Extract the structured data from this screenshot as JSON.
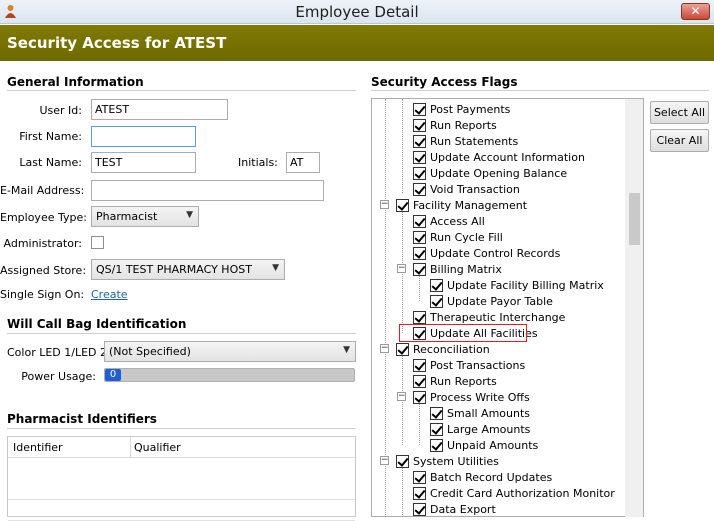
{
  "window": {
    "title": "Employee Detail",
    "close_label": "✕"
  },
  "header": {
    "title": "Security Access for ATEST"
  },
  "general": {
    "title": "General Information",
    "user_id_label": "User Id:",
    "user_id": "ATEST",
    "first_name_label": "First Name:",
    "first_name": "",
    "last_name_label": "Last Name:",
    "last_name": "TEST",
    "initials_label": "Initials:",
    "initials": "AT",
    "email_label": "E-Mail Address:",
    "email": "",
    "employee_type_label": "Employee Type:",
    "employee_type": "Pharmacist",
    "administrator_label": "Administrator:",
    "assigned_store_label": "Assigned Store:",
    "assigned_store": "QS/1 TEST PHARMACY HOST",
    "sso_label": "Single Sign On:",
    "sso_link": "Create"
  },
  "will_call": {
    "title": "Will Call Bag Identification",
    "color_label": "Color LED 1/LED 2:",
    "color_value": "(Not Specified)",
    "power_label": "Power Usage:",
    "power_value": "0"
  },
  "pharmacist_ids": {
    "title": "Pharmacist Identifiers",
    "columns": [
      "Identifier",
      "Qualifier"
    ]
  },
  "security": {
    "title": "Security Access Flags",
    "select_all": "Select All",
    "clear_all": "Clear All",
    "flags": [
      "Post Payments",
      "Run Reports",
      "Run Statements",
      "Update Account Information",
      "Update Opening Balance",
      "Void Transaction",
      "Facility Management",
      "Access All",
      "Run Cycle Fill",
      "Update Control Records",
      "Billing Matrix",
      "Update Facility Billing Matrix",
      "Update Payor Table",
      "Therapeutic Interchange",
      "Update All Facilities",
      "Reconciliation",
      "Post Transactions",
      "Run Reports",
      "Process Write Offs",
      "Small Amounts",
      "Large Amounts",
      "Unpaid Amounts",
      "System Utilities",
      "Batch Record Updates",
      "Credit Card Authorization Monitor",
      "Data Export"
    ]
  }
}
